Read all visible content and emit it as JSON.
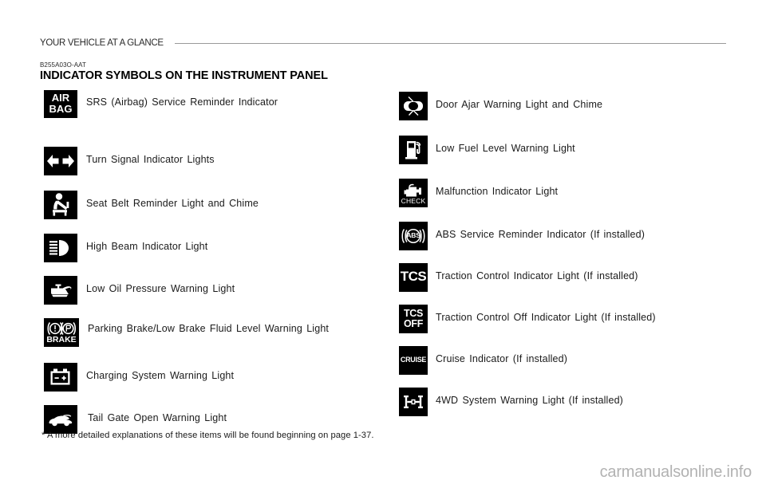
{
  "header": {
    "title": "YOUR VEHICLE AT A GLANCE"
  },
  "section": {
    "code": "B255A03O-AAT",
    "title": "INDICATOR SYMBOLS ON THE INSTRUMENT PANEL"
  },
  "colors": {
    "icon_background": "#000000",
    "icon_foreground": "#ffffff",
    "rule": "#9a9a9a",
    "text": "#1a1a1a",
    "watermark": "#b2b2b2"
  },
  "left_column": [
    {
      "icon": "airbag-icon",
      "icon_text_line1": "AIR",
      "icon_text_line2": "BAG",
      "label": "SRS (Airbag) Service Reminder Indicator"
    },
    {
      "icon": "turn-signal-icon",
      "label": "Turn Signal Indicator Lights"
    },
    {
      "icon": "seat-belt-icon",
      "label": "Seat Belt Reminder Light and Chime"
    },
    {
      "icon": "high-beam-icon",
      "label": "High Beam Indicator Light"
    },
    {
      "icon": "oil-can-icon",
      "label": "Low Oil Pressure Warning Light"
    },
    {
      "icon": "parking-brake-icon",
      "icon_text": "BRAKE",
      "label": "Parking Brake/Low Brake Fluid Level Warning Light"
    },
    {
      "icon": "battery-icon",
      "label": "Charging System Warning Light"
    },
    {
      "icon": "tail-gate-icon",
      "label": "Tail Gate Open Warning Light"
    }
  ],
  "right_column": [
    {
      "icon": "door-ajar-icon",
      "label": "Door Ajar Warning Light and Chime"
    },
    {
      "icon": "fuel-pump-icon",
      "label": "Low Fuel Level Warning Light"
    },
    {
      "icon": "engine-check-icon",
      "icon_text": "CHECK",
      "label": "Malfunction Indicator Light"
    },
    {
      "icon": "abs-icon",
      "icon_text": "ABS",
      "label": "ABS Service Reminder Indicator (If installed)"
    },
    {
      "icon": "tcs-icon",
      "icon_text": "TCS",
      "label": "Traction Control Indicator Light (If installed)"
    },
    {
      "icon": "tcs-off-icon",
      "icon_text_line1": "TCS",
      "icon_text_line2": "OFF",
      "label": "Traction Control Off Indicator Light (If installed)"
    },
    {
      "icon": "cruise-icon",
      "icon_text": "CRUISE",
      "label": "Cruise Indicator (If installed)"
    },
    {
      "icon": "four-wd-icon",
      "label": "4WD System Warning Light (If installed)"
    }
  ],
  "footnote": "* A more detailed explanations of these items will be found beginning on page 1-37.",
  "watermark": "carmanualsonline.info"
}
